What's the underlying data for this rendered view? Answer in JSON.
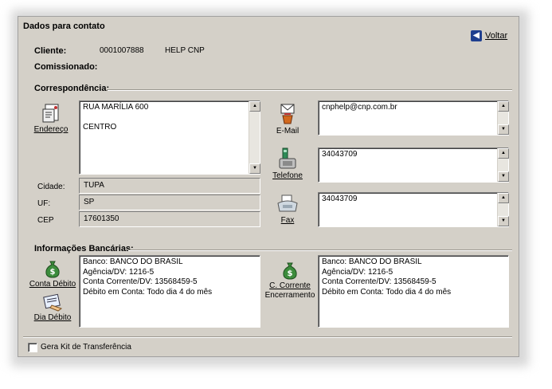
{
  "window": {
    "title": "Dados para contato"
  },
  "toolbar": {
    "voltar_label": "Voltar",
    "voltar_icon": "back-arrow-icon"
  },
  "cliente": {
    "label": "Cliente:",
    "code": "0001007888",
    "name": "HELP CNP"
  },
  "comissionado": {
    "label": "Comissionado:"
  },
  "correspondencia": {
    "heading": "Correspondência:",
    "endereco_label": "Endereço",
    "address_lines": [
      "RUA MARÍLIA 600",
      "",
      "CENTRO"
    ],
    "cidade_label": "Cidade:",
    "cidade_value": "TUPA",
    "uf_label": "UF:",
    "uf_value": "SP",
    "cep_label": "CEP",
    "cep_value": "17601350",
    "email_label": "E-Mail",
    "email_value": "cnphelp@cnp.com.br",
    "telefone_label": "Telefone",
    "telefone_value": "34043709",
    "fax_label": "Fax",
    "fax_value": "34043709"
  },
  "bancarias": {
    "heading": "Informações Bancárias:",
    "conta_debito_label": "Conta Débito",
    "dia_debito_label": "Dia Débito",
    "cc_encerramento_label_1": "C. Corrente",
    "cc_encerramento_label_2": "Encerramento",
    "left_lines": [
      "Banco: BANCO DO BRASIL",
      "Agência/DV: 1216-5",
      "Conta Corrente/DV: 13568459-5",
      "Débito em Conta: Todo dia 4 do mês"
    ],
    "right_lines": [
      "Banco: BANCO DO BRASIL",
      "Agência/DV: 1216-5",
      "Conta Corrente/DV: 13568459-5",
      "Débito em Conta: Todo dia 4 do mês"
    ]
  },
  "footer": {
    "gera_kit_label": "Gera Kit de Transferência",
    "gera_kit_checked": false
  },
  "colors": {
    "window_bg": "#d4d0c8",
    "accent": "#1f3f8f"
  }
}
